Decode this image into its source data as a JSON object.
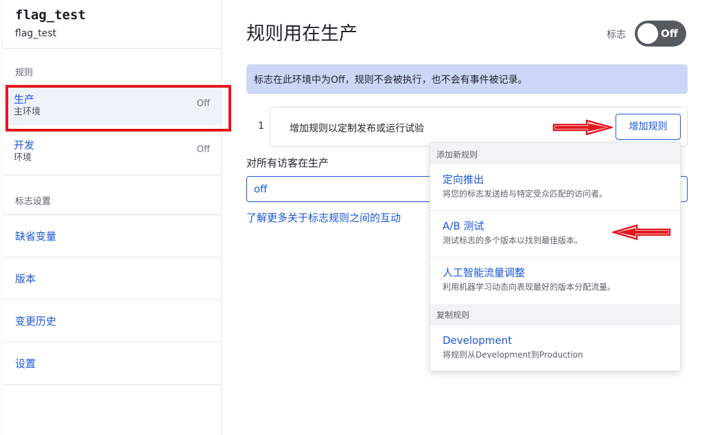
{
  "sidebar": {
    "flag_title": "flag_test",
    "flag_key": "flag_test",
    "rules_section": "规则",
    "environments": [
      {
        "name": "生产",
        "sub": "主环境",
        "state": "Off",
        "active": true
      },
      {
        "name": "开发",
        "sub": "环境",
        "state": "Off",
        "active": false
      }
    ],
    "settings_section": "标志设置",
    "links": [
      "缺省变量",
      "版本",
      "变更历史",
      "设置"
    ]
  },
  "main": {
    "title": "规则用在生产",
    "toggle_label": "标志",
    "toggle_text": "Off",
    "notice": "标志在此环境中为Off，规则不会被执行，也不会有事件被记录。",
    "rule_number": "1",
    "rule_placeholder": "增加规则以定制发布或运行试验",
    "add_rule_button": "增加规则",
    "all_visitors_label": "对所有访客在生产",
    "default_value": "off",
    "learn_more_link": "了解更多关于标志规则之间的互动"
  },
  "dropdown": {
    "section_new": "添加新规则",
    "items": [
      {
        "title": "定向推出",
        "desc": "将您的标志发送给与特定受众匹配的访问者。"
      },
      {
        "title": "A/B 测试",
        "desc": "测试标志的多个版本以找到最佳版本。"
      },
      {
        "title": "人工智能流量调整",
        "desc": "利用机器学习动态向表现最好的版本分配流量。"
      }
    ],
    "section_copy": "复制规则",
    "copy_item": {
      "title": "Development",
      "desc": "将规则从Development到Production"
    }
  },
  "colors": {
    "link_blue": "#1a56db",
    "highlight_red": "#e3161c",
    "notice_bg": "#ccd7f7",
    "toggle_bg": "#555a61"
  },
  "icons": {
    "annotation_arrow_right": "red-arrow-right-icon",
    "annotation_arrow_left": "red-arrow-left-icon"
  }
}
